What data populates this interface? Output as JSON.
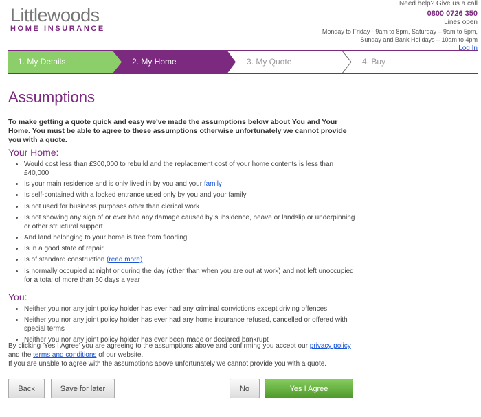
{
  "header": {
    "logo_brand": "Littlewoods",
    "logo_sub": "HOME INSURANCE",
    "help_text": "Need help? Give us a call",
    "phone": "0800 0726 350",
    "lines_open": "Lines open",
    "hours_1": "Monday to Friday - 9am to 8pm, Saturday – 9am to 5pm,",
    "hours_2": "Sunday and Bank Holidays – 10am to 4pm",
    "login": "Log In"
  },
  "steps": [
    {
      "label": "1. My Details",
      "state": "complete",
      "color": "#8ccf6a"
    },
    {
      "label": "2. My Home",
      "state": "active",
      "color": "#7b2a7f"
    },
    {
      "label": "3. My Quote",
      "state": "upcoming"
    },
    {
      "label": "4. Buy",
      "state": "upcoming"
    }
  ],
  "page_title": "Assumptions",
  "intro": "To make getting a quote quick and easy we've made the assumptions below about You and Your Home. You must be able to agree to these assumptions otherwise unfortunately we cannot provide you with a quote.",
  "home": {
    "heading": "Your Home:",
    "items": [
      {
        "text": "Would cost less than £300,000 to rebuild and the replacement cost of your home contents is less than £40,000"
      },
      {
        "text": "Is your main residence and is only lived in by you and your ",
        "link": "family"
      },
      {
        "text": "Is self-contained with a locked entrance used only by you and your family"
      },
      {
        "text": "Is not used for business purposes other than clerical work"
      },
      {
        "text": "Is not showing any sign of or ever had any damage caused by subsidence, heave or landslip or underpinning or other structural support"
      },
      {
        "text": "And land belonging to your home is free from flooding"
      },
      {
        "text": "Is in a good state of repair"
      },
      {
        "text": "Is of standard construction ",
        "link": "(read more)"
      },
      {
        "text": "Is normally occupied at night or during the day (other than when you are out at work) and not left unoccupied for a total of more than 60 days a year"
      }
    ]
  },
  "you": {
    "heading": "You:",
    "items": [
      "Neither you nor any joint policy holder has ever had any criminal convictions except driving offences",
      "Neither you nor any joint policy holder has ever had any home insurance refused, cancelled or offered with special terms",
      "Neither you nor any joint policy holder has ever been made or declared bankrupt"
    ]
  },
  "footer": {
    "agree_pre": "By clicking 'Yes I Agree' you are agreeing to the assumptions above and confirming you accept our ",
    "privacy_link": "privacy policy",
    "agree_mid": " and the ",
    "terms_link": "terms and conditions",
    "agree_post": " of our website.",
    "unable": "If you are unable to agree with the assumptions above unfortunately we cannot provide you with a quote."
  },
  "buttons": {
    "back": "Back",
    "save": "Save for later",
    "no": "No",
    "yes": "Yes I Agree"
  }
}
